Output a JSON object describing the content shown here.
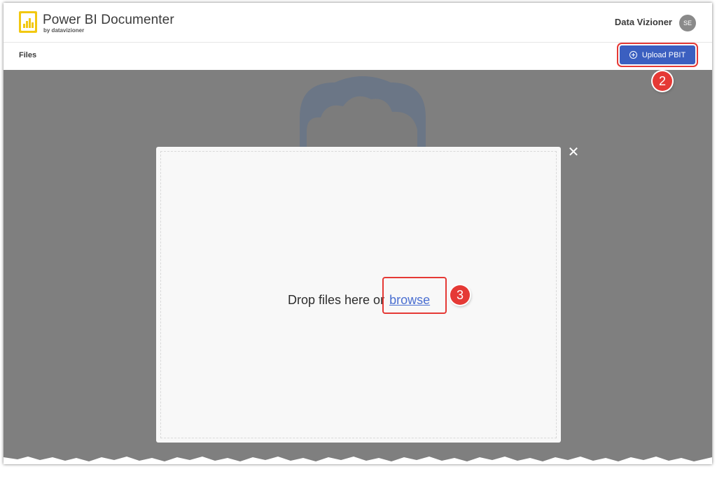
{
  "header": {
    "app_title": "Power BI Documenter",
    "app_subtitle": "by datavizioner",
    "user_name": "Data Vizioner",
    "avatar_initials": "SE"
  },
  "subbar": {
    "files_label": "Files",
    "upload_button_label": "Upload PBIT"
  },
  "annotations": {
    "step_upload": "2",
    "step_browse": "3"
  },
  "modal": {
    "drop_text": "Drop files here or",
    "browse_link": "browse",
    "close_icon": "close-icon"
  },
  "colors": {
    "accent": "#3b5fc0",
    "logo": "#f2c811",
    "annotation": "#e53935",
    "overlay": "#7f7f7f"
  }
}
